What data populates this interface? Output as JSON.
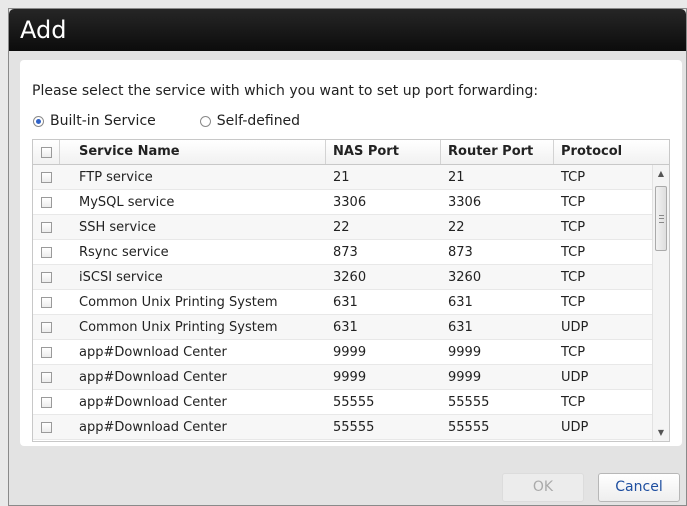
{
  "dialog": {
    "title": "Add",
    "prompt": "Please select the service with which you want to set up port forwarding:",
    "options": [
      {
        "label": "Built-in Service",
        "selected": true
      },
      {
        "label": "Self-defined",
        "selected": false
      }
    ]
  },
  "table": {
    "headers": {
      "name": "Service Name",
      "nas": "NAS Port",
      "router": "Router Port",
      "protocol": "Protocol"
    },
    "rows": [
      {
        "name": "FTP service",
        "nas": "21",
        "router": "21",
        "protocol": "TCP"
      },
      {
        "name": "MySQL service",
        "nas": "3306",
        "router": "3306",
        "protocol": "TCP"
      },
      {
        "name": "SSH service",
        "nas": "22",
        "router": "22",
        "protocol": "TCP"
      },
      {
        "name": "Rsync service",
        "nas": "873",
        "router": "873",
        "protocol": "TCP"
      },
      {
        "name": "iSCSI service",
        "nas": "3260",
        "router": "3260",
        "protocol": "TCP"
      },
      {
        "name": "Common Unix Printing System",
        "nas": "631",
        "router": "631",
        "protocol": "TCP"
      },
      {
        "name": "Common Unix Printing System",
        "nas": "631",
        "router": "631",
        "protocol": "UDP"
      },
      {
        "name": "app#Download Center",
        "nas": "9999",
        "router": "9999",
        "protocol": "TCP"
      },
      {
        "name": "app#Download Center",
        "nas": "9999",
        "router": "9999",
        "protocol": "UDP"
      },
      {
        "name": "app#Download Center",
        "nas": "55555",
        "router": "55555",
        "protocol": "TCP"
      },
      {
        "name": "app#Download Center",
        "nas": "55555",
        "router": "55555",
        "protocol": "UDP"
      }
    ]
  },
  "buttons": {
    "ok": "OK",
    "cancel": "Cancel"
  },
  "colors": {
    "accent": "#2f62c8",
    "cancel_text": "#1f4fa0",
    "titlebar": "#111111"
  }
}
